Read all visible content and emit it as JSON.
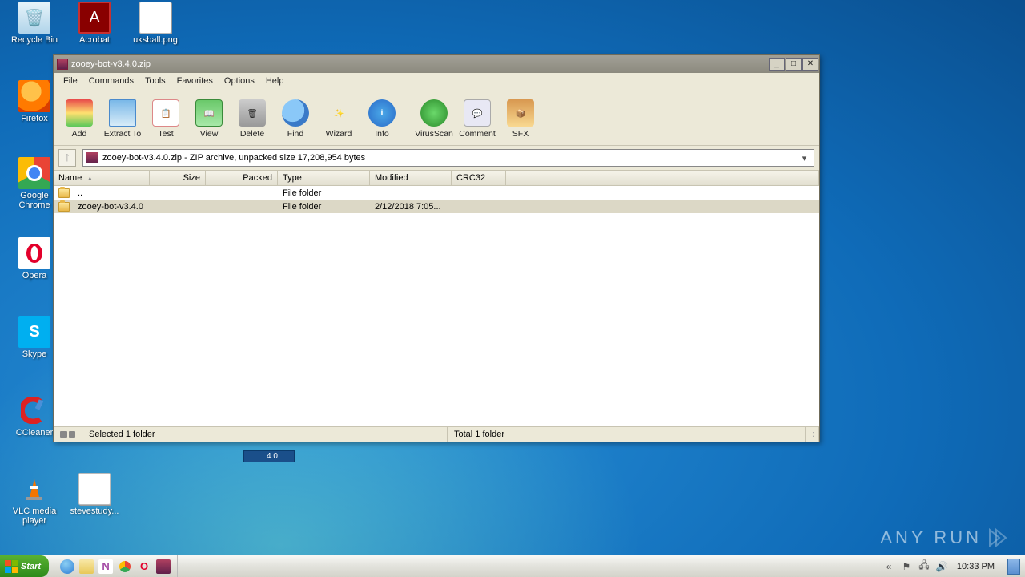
{
  "desktop": {
    "icons": [
      {
        "label": "Recycle Bin"
      },
      {
        "label": "Acrobat"
      },
      {
        "label": "uksball.png"
      },
      {
        "label": "Firefox"
      },
      {
        "label": "Google Chrome"
      },
      {
        "label": "Opera"
      },
      {
        "label": "Skype"
      },
      {
        "label": "CCleaner"
      },
      {
        "label": "VLC media player"
      },
      {
        "label": "stevestudy..."
      }
    ]
  },
  "window": {
    "title": "zooey-bot-v3.4.0.zip",
    "menu": [
      "File",
      "Commands",
      "Tools",
      "Favorites",
      "Options",
      "Help"
    ],
    "toolbar": [
      {
        "label": "Add"
      },
      {
        "label": "Extract To"
      },
      {
        "label": "Test"
      },
      {
        "label": "View"
      },
      {
        "label": "Delete"
      },
      {
        "label": "Find"
      },
      {
        "label": "Wizard"
      },
      {
        "label": "Info"
      },
      {
        "sep": true
      },
      {
        "label": "VirusScan"
      },
      {
        "label": "Comment"
      },
      {
        "label": "SFX"
      }
    ],
    "address": "zooey-bot-v3.4.0.zip - ZIP archive, unpacked size 17,208,954 bytes",
    "columns": {
      "name": "Name",
      "size": "Size",
      "packed": "Packed",
      "type": "Type",
      "modified": "Modified",
      "crc": "CRC32"
    },
    "rows": [
      {
        "name": "..",
        "type": "File folder",
        "modified": "",
        "selected": false
      },
      {
        "name": "zooey-bot-v3.4.0",
        "type": "File folder",
        "modified": "2/12/2018 7:05...",
        "selected": true
      }
    ],
    "status": {
      "selected": "Selected 1 folder",
      "total": "Total 1 folder"
    }
  },
  "taskbar": {
    "start": "Start",
    "clock": "10:33 PM"
  },
  "watermark": "ANY RUN",
  "aux": {
    "stray_label": "4.0",
    "winctrl_min": "_",
    "winctrl_max": "□",
    "winctrl_close": "✕",
    "up_arrow": "↑",
    "dd_arrow": "▾",
    "sort_asc": "▲",
    "resize": ".::"
  }
}
